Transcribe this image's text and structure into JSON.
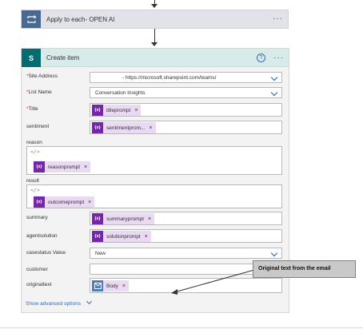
{
  "apply_each": {
    "title": "Apply to each- OPEN AI",
    "more": "···"
  },
  "create_item": {
    "title": "Create item",
    "help": "?",
    "more": "···",
    "icon_letter": "S",
    "fields": {
      "site_address": {
        "label": "Site Address",
        "value": "- https://microsoft.sharepoint.com/teams/"
      },
      "list_name": {
        "label": "List Name",
        "value": "Conversation Insights"
      },
      "title": {
        "label": "Title",
        "token": "titleprompt"
      },
      "sentiment": {
        "label": "sentiment",
        "token": "sentimentprom..."
      },
      "reason": {
        "label": "reason",
        "token": "reasonprompt"
      },
      "result": {
        "label": "result",
        "token": "outcomeprompt"
      },
      "summary": {
        "label": "summary",
        "token": "summaryprompt"
      },
      "agentsolution": {
        "label": "agentsolution",
        "token": "solutionprompt"
      },
      "casestatus": {
        "label": "casestatus Value",
        "value": "New"
      },
      "customer": {
        "label": "customer",
        "value": ""
      },
      "originaltext": {
        "label": "originaltext",
        "token": "Body"
      }
    },
    "required_mark": "*",
    "token_icon": "{x}",
    "code_icon": "</>",
    "token_remove": "×",
    "advanced_options": "Show advanced options"
  },
  "callout": {
    "text": "Original text from the email"
  },
  "icons": [
    "loop-icon",
    "sharepoint-icon",
    "help-icon",
    "chevron-down-icon",
    "expression-icon",
    "code-icon",
    "remove-icon"
  ]
}
